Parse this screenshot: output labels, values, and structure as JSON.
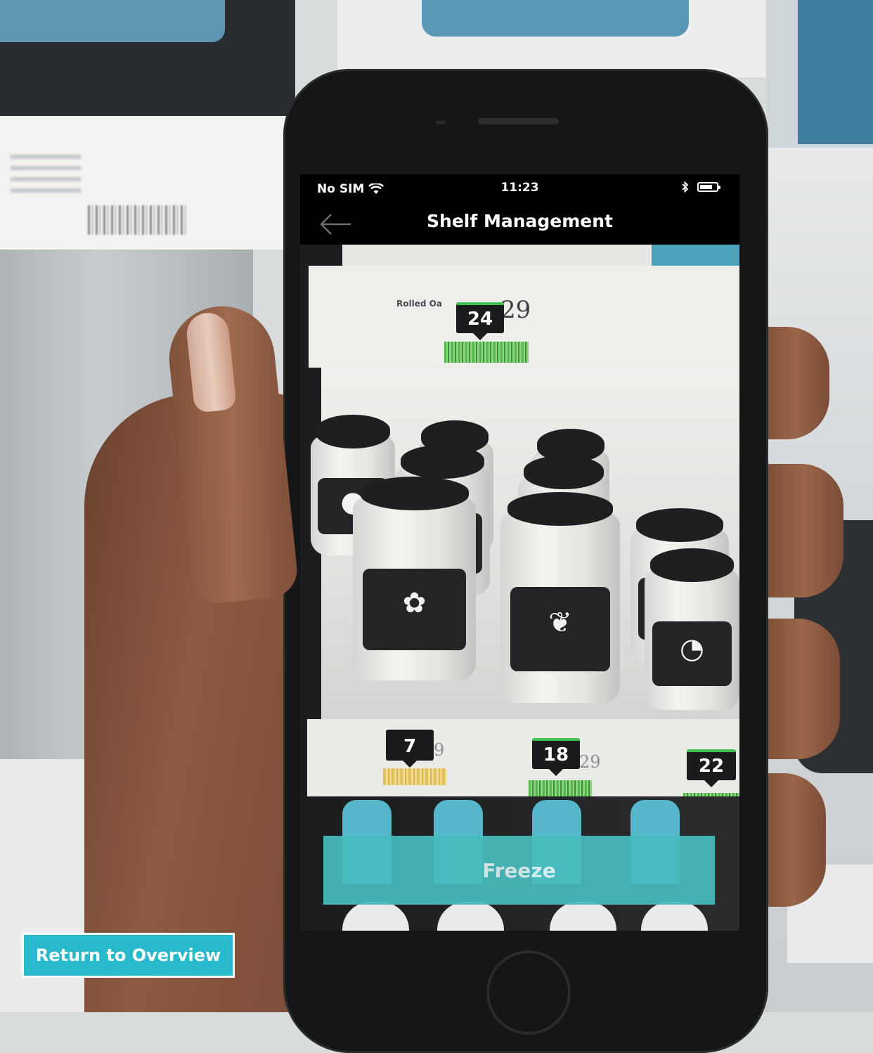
{
  "status_bar": {
    "carrier": "No SIM",
    "time": "11:23",
    "wifi_icon": "wifi-icon",
    "bluetooth_icon": "bluetooth-icon",
    "battery_icon": "battery-icon"
  },
  "nav": {
    "title": "Shelf Management",
    "back_icon": "arrow-left-icon"
  },
  "labels": [
    {
      "product": "Rolled Oa",
      "price": "29",
      "count": "24",
      "barcode": "green"
    },
    {
      "product": "",
      "price": "9",
      "count": "7",
      "barcode": "yellow"
    },
    {
      "product": "",
      "price": "29",
      "count": "18",
      "barcode": "green"
    },
    {
      "product": "",
      "price": "",
      "count": "22",
      "barcode": "green"
    }
  ],
  "freeze_button": {
    "label": "Freeze"
  },
  "return_button": {
    "label": "Return to Overview"
  },
  "colors": {
    "accent": "#28b9cd",
    "freeze": "#47bcbf",
    "count_ok": "#3fc14f",
    "count_low": "#e3c15a"
  }
}
